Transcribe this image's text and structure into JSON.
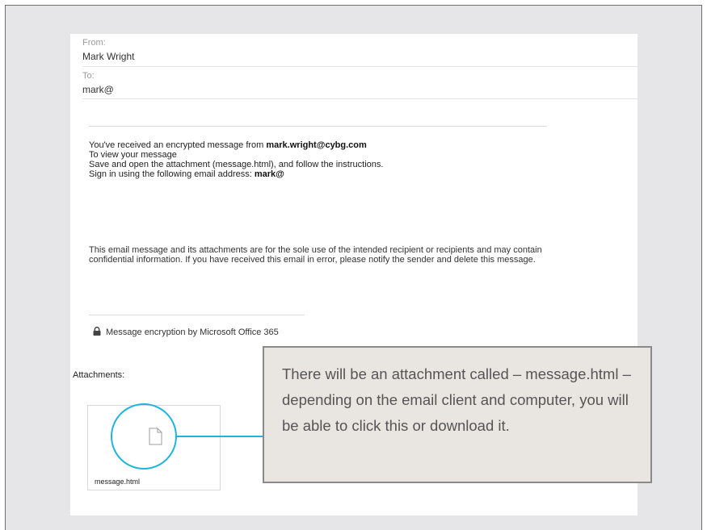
{
  "email": {
    "from_label": "From:",
    "from_value": "Mark Wright",
    "to_label": "To:",
    "to_value": "mark@",
    "body": {
      "line1_prefix": "You've received an encrypted message from ",
      "line1_sender": "mark.wright@cybg.com",
      "line2": "To view your message",
      "line3": "Save and open the attachment (message.html), and follow the instructions.",
      "line4_prefix": "Sign in using the following email address: ",
      "line4_address": "mark@"
    },
    "disclaimer": "This email message and its attachments are for the sole use of the intended recipient or recipients and may contain confidential information. If you have received this email in error, please notify the sender and delete this message.",
    "encryption_note": "Message encryption by Microsoft Office 365",
    "attachments_label": "Attachments:",
    "attachment": {
      "file_name": "message.html",
      "icon": "file-icon"
    }
  },
  "callout": {
    "text": "There will be an attachment called – message.html – depending on the email client and computer, you will be able to click this or download it."
  },
  "colors": {
    "frame_background": "#e6e6e8",
    "highlight": "#1eb4de",
    "callout_background": "#e9e6e1",
    "callout_border": "#8a8a8a"
  }
}
